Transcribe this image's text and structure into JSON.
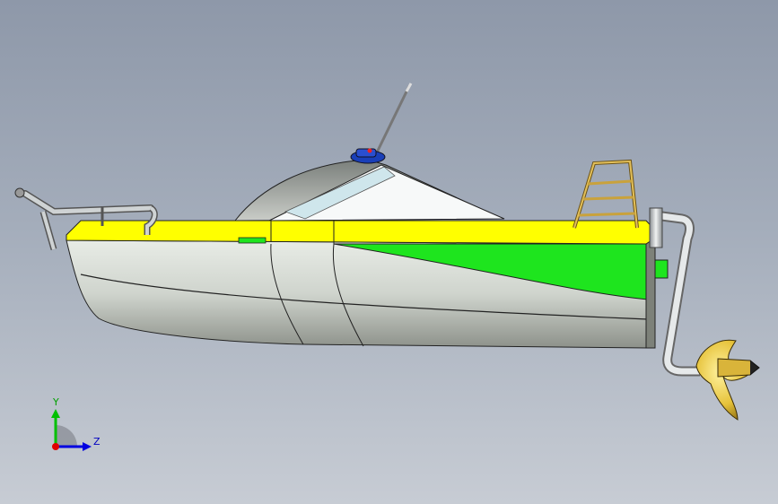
{
  "viewport": {
    "background_top": "#8e98a9",
    "background_bottom": "#c7ccd4"
  },
  "model": {
    "hull_colors": {
      "deck": "#ffff00",
      "stripe": "#1ee51e",
      "hull": "#d9dcd8",
      "cabin": "#f4f6f6"
    },
    "parts": [
      "hull",
      "deck",
      "cabin",
      "windshield",
      "antenna",
      "beacon",
      "bow-rail",
      "stern-ladder",
      "exhaust-pipe",
      "propeller"
    ]
  },
  "triad": {
    "y_label": "Y",
    "z_label": "Z",
    "colors": {
      "y": "#00c000",
      "z": "#0000e0",
      "x": "#e00000"
    }
  }
}
